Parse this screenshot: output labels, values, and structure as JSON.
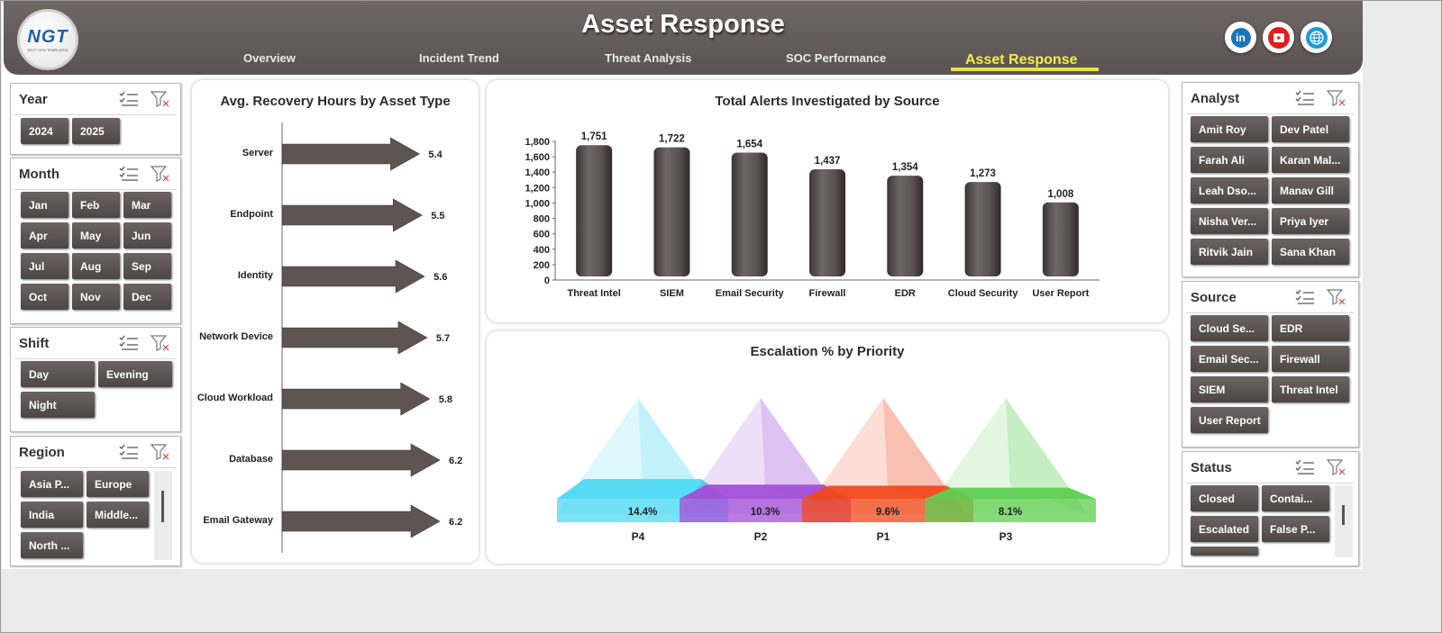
{
  "header": {
    "title": "Asset Response",
    "logo_text": "NGT",
    "logo_subtext": "NEXT GEN TEMPLATES",
    "tabs": [
      {
        "label": "Overview"
      },
      {
        "label": "Incident Trend"
      },
      {
        "label": "Threat Analysis"
      },
      {
        "label": "SOC Performance"
      },
      {
        "label": "Asset Response"
      }
    ],
    "active_tab": "Asset Response",
    "social": [
      {
        "icon": "linkedin-icon",
        "label": "in"
      },
      {
        "icon": "youtube-icon"
      },
      {
        "icon": "globe-icon"
      }
    ]
  },
  "slicers_left": {
    "year": {
      "title": "Year",
      "items": [
        "2024",
        "2025"
      ]
    },
    "month": {
      "title": "Month",
      "items": [
        "Jan",
        "Feb",
        "Mar",
        "Apr",
        "May",
        "Jun",
        "Jul",
        "Aug",
        "Sep",
        "Oct",
        "Nov",
        "Dec"
      ]
    },
    "shift": {
      "title": "Shift",
      "items": [
        "Day",
        "Evening",
        "Night"
      ]
    },
    "region": {
      "title": "Region",
      "items": [
        "Asia P...",
        "Europe",
        "India",
        "Middle...",
        "North ..."
      ]
    }
  },
  "slicers_right": {
    "analyst": {
      "title": "Analyst",
      "items": [
        "Amit Roy",
        "Dev Patel",
        "Farah Ali",
        "Karan Mal...",
        "Leah Dso...",
        "Manav Gill",
        "Nisha Ver...",
        "Priya Iyer",
        "Ritvik Jain",
        "Sana Khan"
      ]
    },
    "source": {
      "title": "Source",
      "items": [
        "Cloud Se...",
        "EDR",
        "Email Sec...",
        "Firewall",
        "SIEM",
        "Threat Intel",
        "User Report"
      ]
    },
    "status": {
      "title": "Status",
      "items": [
        "Closed",
        "Contai...",
        "Escalated",
        "False P..."
      ]
    }
  },
  "chart_data": [
    {
      "type": "bar",
      "orientation": "horizontal",
      "title": "Avg. Recovery Hours by Asset Type",
      "categories": [
        "Server",
        "Endpoint",
        "Identity",
        "Network Device",
        "Cloud Workload",
        "Database",
        "Email Gateway"
      ],
      "values": [
        5.4,
        5.5,
        5.6,
        5.7,
        5.8,
        6.2,
        6.2
      ],
      "color": "#5e5553"
    },
    {
      "type": "bar",
      "title": "Total Alerts Investigated by Source",
      "categories": [
        "Threat Intel",
        "SIEM",
        "Email Security",
        "Firewall",
        "EDR",
        "Cloud Security",
        "User Report"
      ],
      "values": [
        1751,
        1722,
        1654,
        1437,
        1354,
        1273,
        1008
      ],
      "value_labels": [
        "1,751",
        "1,722",
        "1,654",
        "1,437",
        "1,354",
        "1,273",
        "1,008"
      ],
      "yticks": [
        "0",
        "200",
        "400",
        "600",
        "800",
        "1,000",
        "1,200",
        "1,400",
        "1,600",
        "1,800"
      ],
      "ylim": [
        0,
        1800
      ],
      "color": "#5a5250"
    },
    {
      "type": "bar",
      "subtype": "pyramid",
      "title": "Escalation % by Priority",
      "categories": [
        "P4",
        "P2",
        "P1",
        "P3"
      ],
      "values": [
        14.4,
        10.3,
        9.6,
        8.1
      ],
      "value_labels": [
        "14.4%",
        "10.3%",
        "9.6%",
        "8.1%"
      ],
      "colors": [
        "#4fd9f2",
        "#a24fd8",
        "#f04a1c",
        "#5fcf52"
      ]
    }
  ]
}
